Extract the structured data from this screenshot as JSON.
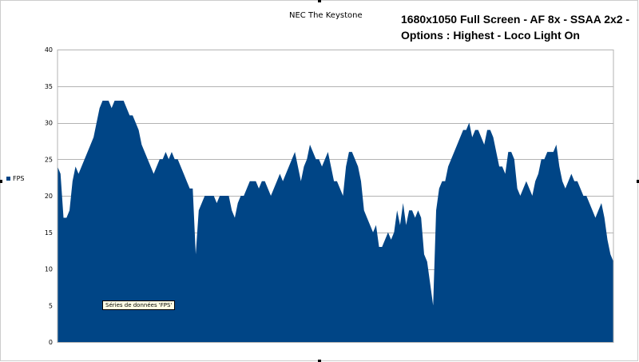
{
  "chart_data": {
    "type": "area",
    "title": "NEC The Keystone",
    "annotation": [
      "1680x1050 Full Screen - AF 8x - SSAA 2x2 -",
      "Options : Highest - Loco Light On"
    ],
    "xlabel": "",
    "ylabel": "",
    "ylim": [
      0,
      40
    ],
    "y_ticks": [
      "0",
      "5",
      "10",
      "15",
      "20",
      "25",
      "30",
      "35",
      "40"
    ],
    "grid": true,
    "legend_position": "left",
    "tooltip": "Séries de données 'FPS'",
    "color": "#004586",
    "series": [
      {
        "name": "FPS",
        "values": [
          24,
          23,
          17,
          17,
          18,
          22,
          24,
          23,
          24,
          25,
          26,
          27,
          28,
          30,
          32,
          33,
          33,
          33,
          32,
          33,
          33,
          33,
          33,
          32,
          31,
          31,
          30,
          29,
          27,
          26,
          25,
          24,
          23,
          24,
          25,
          25,
          26,
          25,
          26,
          25,
          25,
          24,
          23,
          22,
          21,
          21,
          12,
          18,
          19,
          20,
          20,
          20,
          20,
          19,
          20,
          20,
          20,
          20,
          18,
          17,
          19,
          20,
          20,
          21,
          22,
          22,
          22,
          21,
          22,
          22,
          21,
          20,
          21,
          22,
          23,
          22,
          23,
          24,
          25,
          26,
          24,
          22,
          24,
          25,
          27,
          26,
          25,
          25,
          24,
          25,
          26,
          24,
          22,
          22,
          21,
          20,
          24,
          26,
          26,
          25,
          24,
          22,
          18,
          17,
          16,
          15,
          16,
          13,
          13,
          14,
          15,
          14,
          15,
          18,
          16,
          19,
          16,
          18,
          18,
          17,
          18,
          17,
          12,
          11,
          8,
          5,
          18,
          21,
          22,
          22,
          24,
          25,
          26,
          27,
          28,
          29,
          29,
          30,
          28,
          29,
          29,
          28,
          27,
          29,
          29,
          28,
          26,
          24,
          24,
          23,
          26,
          26,
          25,
          21,
          20,
          21,
          22,
          21,
          20,
          22,
          23,
          25,
          25,
          26,
          26,
          26,
          27,
          24,
          22,
          21,
          22,
          23,
          22,
          22,
          21,
          20,
          20,
          19,
          18,
          17,
          18,
          19,
          17,
          14,
          12,
          11
        ]
      }
    ]
  }
}
